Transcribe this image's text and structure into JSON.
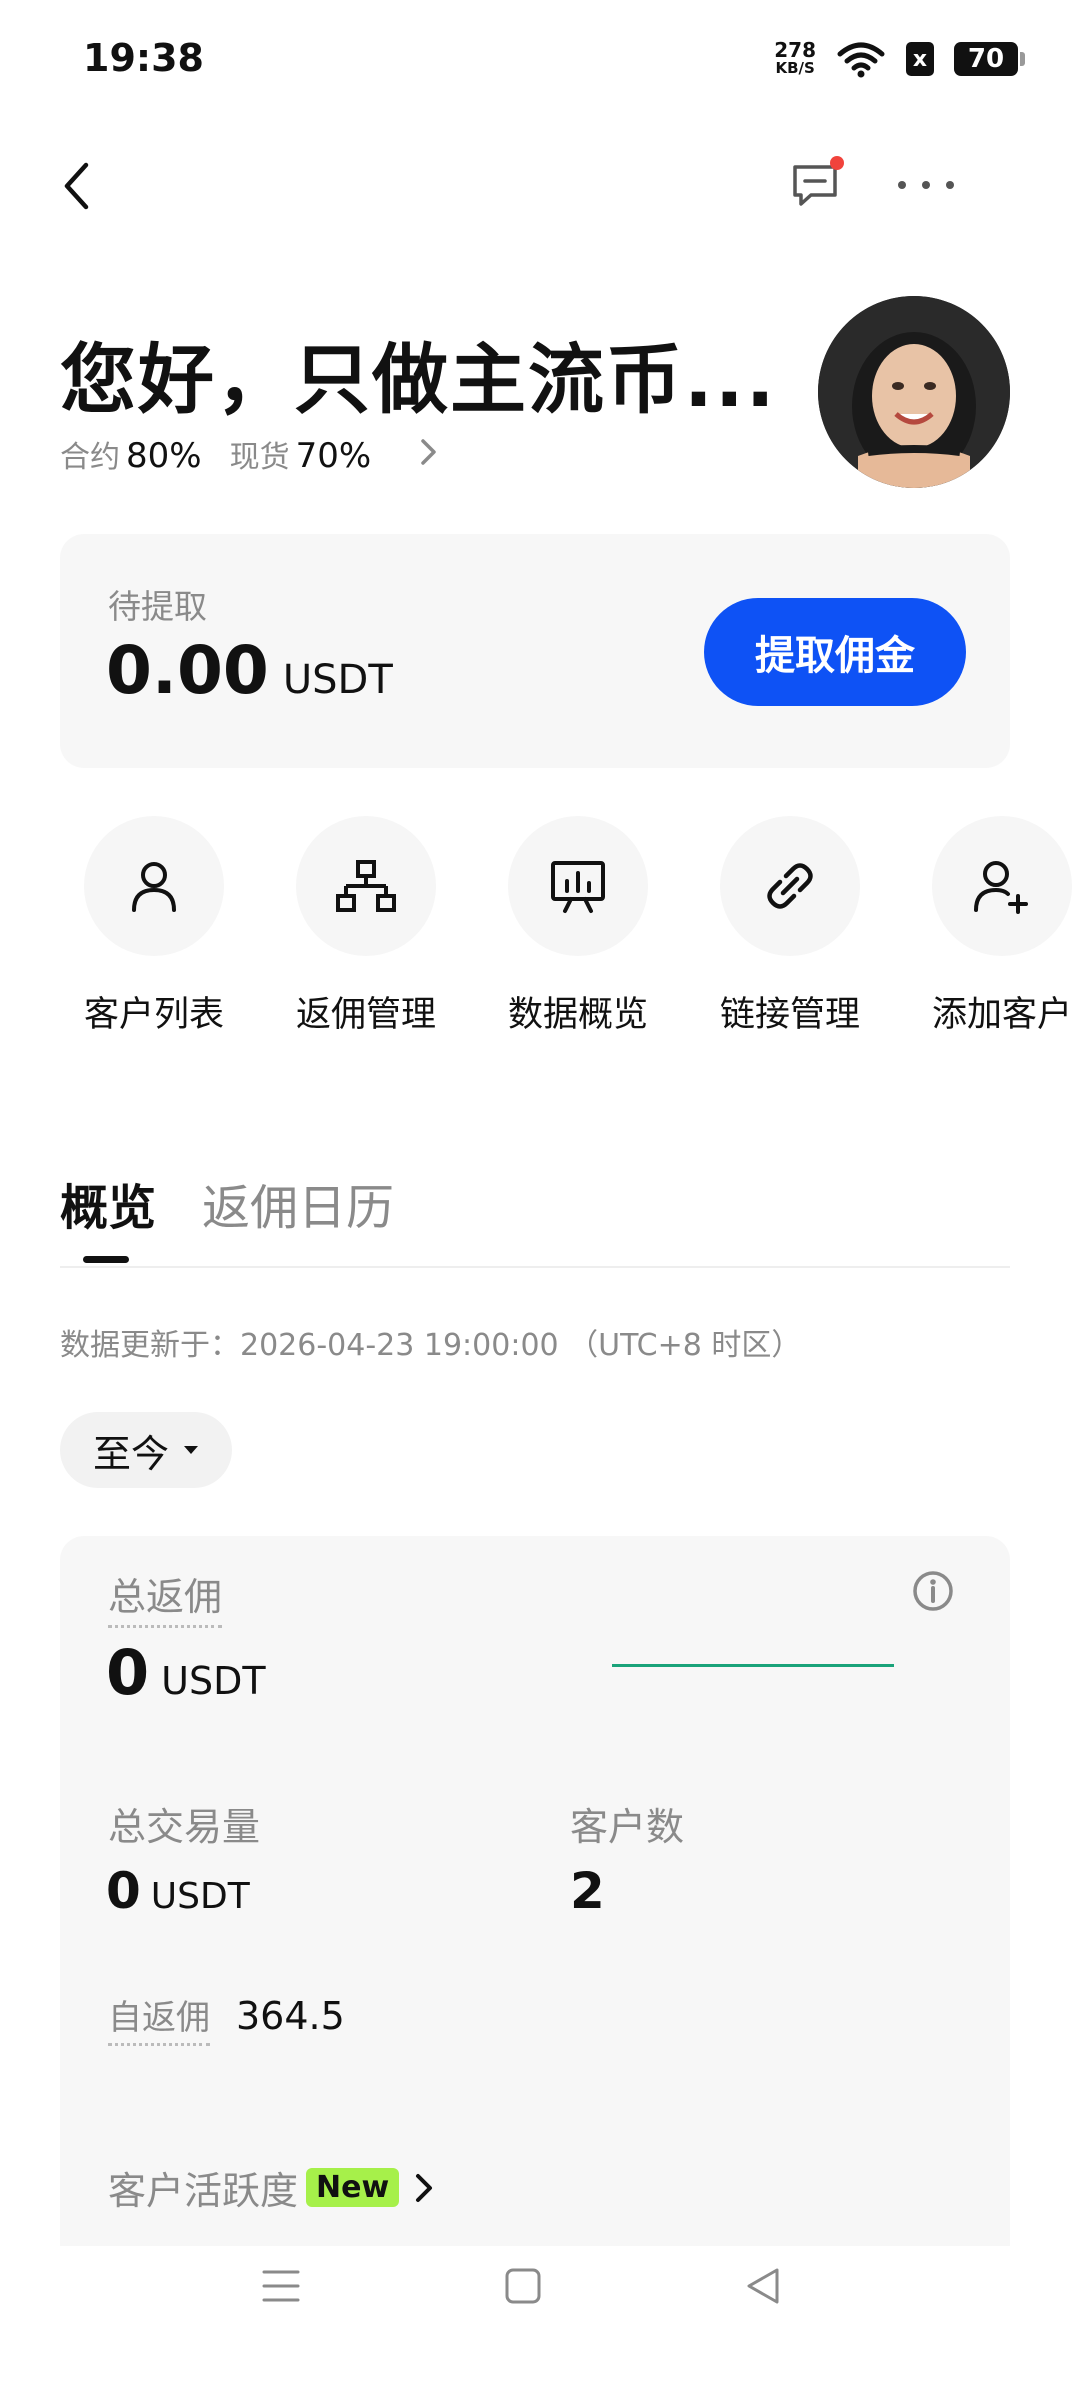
{
  "status_bar": {
    "time": "19:38",
    "net_speed_value": "278",
    "net_speed_unit": "KB/S",
    "sim_icon": "x",
    "battery": "70"
  },
  "header": {
    "greeting": "您好，只做主流币...",
    "rates": [
      {
        "label": "合约",
        "value": "80%"
      },
      {
        "label": "现货",
        "value": "70%"
      }
    ]
  },
  "commission": {
    "label": "待提取",
    "amount": "0.00",
    "unit": "USDT",
    "button_label": "提取佣金"
  },
  "quick_actions": [
    {
      "label": "客户列表",
      "icon": "person-icon"
    },
    {
      "label": "返佣管理",
      "icon": "org-chart-icon"
    },
    {
      "label": "数据概览",
      "icon": "presentation-chart-icon"
    },
    {
      "label": "链接管理",
      "icon": "link-icon"
    },
    {
      "label": "添加客户",
      "icon": "add-person-icon"
    }
  ],
  "tabs": [
    {
      "label": "概览",
      "active": true
    },
    {
      "label": "返佣日历",
      "active": false
    }
  ],
  "update_note": "数据更新于：2026-04-23 19:00:00 （UTC+8 时区）",
  "period": {
    "selected": "至今"
  },
  "stats": {
    "total_rebate_label": "总返佣",
    "total_rebate_value": "0",
    "total_rebate_unit": "USDT",
    "volume_label": "总交易量",
    "volume_value": "0",
    "volume_unit": "USDT",
    "clients_label": "客户数",
    "clients_value": "2",
    "self_rebate_label": "自返佣",
    "self_rebate_value": "364.5",
    "activity_label": "客户活跃度",
    "activity_badge": "New"
  },
  "colors": {
    "accent": "#0e52f5",
    "notify": "#f1433c",
    "spark": "#1aa37a",
    "badge": "#a6f04a"
  }
}
